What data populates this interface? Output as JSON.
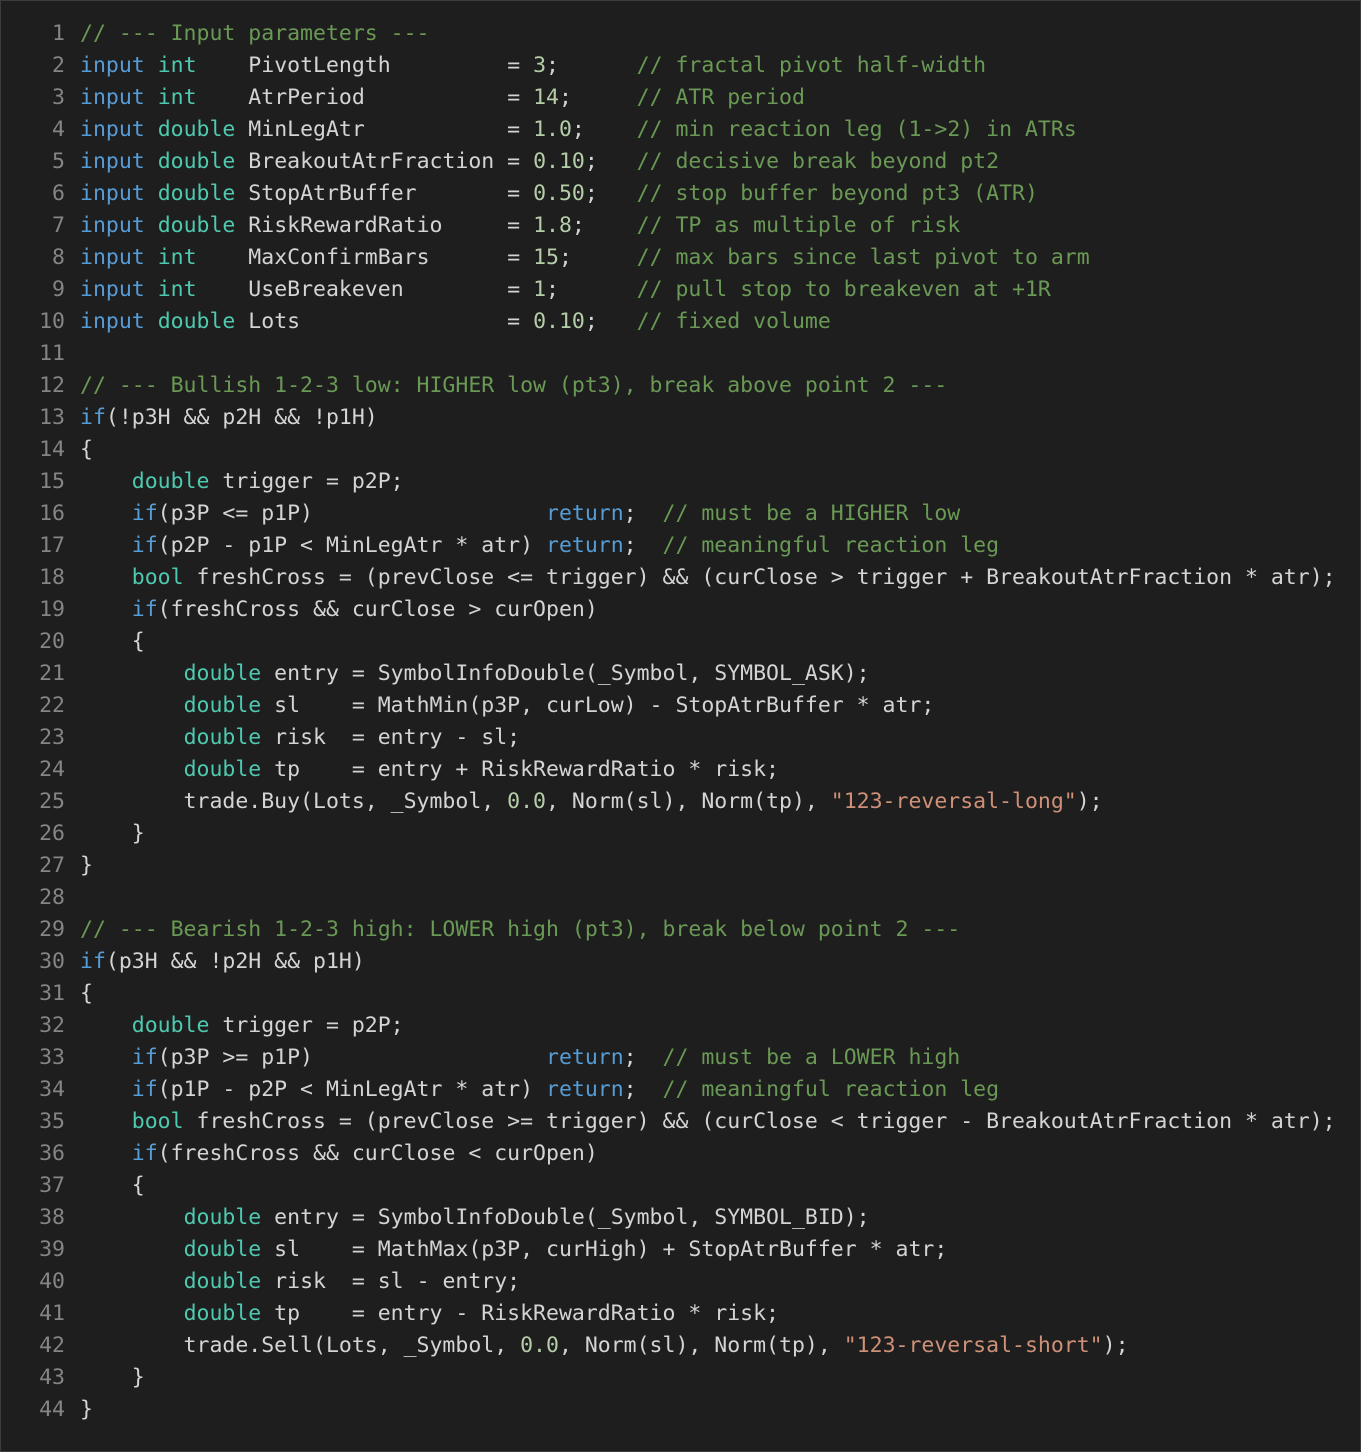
{
  "editor": {
    "background": "#1e1e1e",
    "colors": {
      "plain": "#d4d4d4",
      "keyword": "#569cd6",
      "type": "#4ec9b0",
      "comment": "#6a9955",
      "number": "#b5cea8",
      "string": "#ce9178",
      "line_number": "#858585"
    },
    "lines": [
      {
        "n": "1",
        "tokens": [
          [
            "cm",
            "// --- Input parameters ---"
          ]
        ]
      },
      {
        "n": "2",
        "tokens": [
          [
            "kw",
            "input"
          ],
          [
            "",
            " "
          ],
          [
            "ty",
            "int"
          ],
          [
            "",
            "    PivotLength         = "
          ],
          [
            "num",
            "3"
          ],
          [
            "",
            ";      "
          ],
          [
            "cm",
            "// fractal pivot half-width"
          ]
        ]
      },
      {
        "n": "3",
        "tokens": [
          [
            "kw",
            "input"
          ],
          [
            "",
            " "
          ],
          [
            "ty",
            "int"
          ],
          [
            "",
            "    AtrPeriod           = "
          ],
          [
            "num",
            "14"
          ],
          [
            "",
            ";     "
          ],
          [
            "cm",
            "// ATR period"
          ]
        ]
      },
      {
        "n": "4",
        "tokens": [
          [
            "kw",
            "input"
          ],
          [
            "",
            " "
          ],
          [
            "ty",
            "double"
          ],
          [
            "",
            " MinLegAtr           = "
          ],
          [
            "num",
            "1.0"
          ],
          [
            "",
            ";    "
          ],
          [
            "cm",
            "// min reaction leg (1->2) in ATRs"
          ]
        ]
      },
      {
        "n": "5",
        "tokens": [
          [
            "kw",
            "input"
          ],
          [
            "",
            " "
          ],
          [
            "ty",
            "double"
          ],
          [
            "",
            " BreakoutAtrFraction = "
          ],
          [
            "num",
            "0.10"
          ],
          [
            "",
            ";   "
          ],
          [
            "cm",
            "// decisive break beyond pt2"
          ]
        ]
      },
      {
        "n": "6",
        "tokens": [
          [
            "kw",
            "input"
          ],
          [
            "",
            " "
          ],
          [
            "ty",
            "double"
          ],
          [
            "",
            " StopAtrBuffer       = "
          ],
          [
            "num",
            "0.50"
          ],
          [
            "",
            ";   "
          ],
          [
            "cm",
            "// stop buffer beyond pt3 (ATR)"
          ]
        ]
      },
      {
        "n": "7",
        "tokens": [
          [
            "kw",
            "input"
          ],
          [
            "",
            " "
          ],
          [
            "ty",
            "double"
          ],
          [
            "",
            " RiskRewardRatio     = "
          ],
          [
            "num",
            "1.8"
          ],
          [
            "",
            ";    "
          ],
          [
            "cm",
            "// TP as multiple of risk"
          ]
        ]
      },
      {
        "n": "8",
        "tokens": [
          [
            "kw",
            "input"
          ],
          [
            "",
            " "
          ],
          [
            "ty",
            "int"
          ],
          [
            "",
            "    MaxConfirmBars      = "
          ],
          [
            "num",
            "15"
          ],
          [
            "",
            ";     "
          ],
          [
            "cm",
            "// max bars since last pivot to arm"
          ]
        ]
      },
      {
        "n": "9",
        "tokens": [
          [
            "kw",
            "input"
          ],
          [
            "",
            " "
          ],
          [
            "ty",
            "int"
          ],
          [
            "",
            "    UseBreakeven        = "
          ],
          [
            "num",
            "1"
          ],
          [
            "",
            ";      "
          ],
          [
            "cm",
            "// pull stop to breakeven at +1R"
          ]
        ]
      },
      {
        "n": "10",
        "tokens": [
          [
            "kw",
            "input"
          ],
          [
            "",
            " "
          ],
          [
            "ty",
            "double"
          ],
          [
            "",
            " Lots                = "
          ],
          [
            "num",
            "0.10"
          ],
          [
            "",
            ";   "
          ],
          [
            "cm",
            "// fixed volume"
          ]
        ]
      },
      {
        "n": "11",
        "tokens": []
      },
      {
        "n": "12",
        "tokens": [
          [
            "cm",
            "// --- Bullish 1-2-3 low: HIGHER low (pt3), break above point 2 ---"
          ]
        ]
      },
      {
        "n": "13",
        "tokens": [
          [
            "kw",
            "if"
          ],
          [
            "",
            "(!p3H && p2H && !p1H)"
          ]
        ]
      },
      {
        "n": "14",
        "tokens": [
          [
            "",
            "{"
          ]
        ]
      },
      {
        "n": "15",
        "tokens": [
          [
            "",
            "    "
          ],
          [
            "ty",
            "double"
          ],
          [
            "",
            " trigger = p2P;"
          ]
        ]
      },
      {
        "n": "16",
        "tokens": [
          [
            "",
            "    "
          ],
          [
            "kw",
            "if"
          ],
          [
            "",
            "(p3P <= p1P)                  "
          ],
          [
            "kw",
            "return"
          ],
          [
            "",
            ";  "
          ],
          [
            "cm",
            "// must be a HIGHER low"
          ]
        ]
      },
      {
        "n": "17",
        "tokens": [
          [
            "",
            "    "
          ],
          [
            "kw",
            "if"
          ],
          [
            "",
            "(p2P - p1P < MinLegAtr * atr) "
          ],
          [
            "kw",
            "return"
          ],
          [
            "",
            ";  "
          ],
          [
            "cm",
            "// meaningful reaction leg"
          ]
        ]
      },
      {
        "n": "18",
        "tokens": [
          [
            "",
            "    "
          ],
          [
            "ty",
            "bool"
          ],
          [
            "",
            " freshCross = (prevClose <= trigger) && (curClose > trigger + BreakoutAtrFraction * atr);"
          ]
        ]
      },
      {
        "n": "19",
        "tokens": [
          [
            "",
            "    "
          ],
          [
            "kw",
            "if"
          ],
          [
            "",
            "(freshCross && curClose > curOpen)"
          ]
        ]
      },
      {
        "n": "20",
        "tokens": [
          [
            "",
            "    {"
          ]
        ]
      },
      {
        "n": "21",
        "tokens": [
          [
            "",
            "        "
          ],
          [
            "ty",
            "double"
          ],
          [
            "",
            " entry = SymbolInfoDouble(_Symbol, SYMBOL_ASK);"
          ]
        ]
      },
      {
        "n": "22",
        "tokens": [
          [
            "",
            "        "
          ],
          [
            "ty",
            "double"
          ],
          [
            "",
            " sl    = MathMin(p3P, curLow) - StopAtrBuffer * atr;"
          ]
        ]
      },
      {
        "n": "23",
        "tokens": [
          [
            "",
            "        "
          ],
          [
            "ty",
            "double"
          ],
          [
            "",
            " risk  = entry - sl;"
          ]
        ]
      },
      {
        "n": "24",
        "tokens": [
          [
            "",
            "        "
          ],
          [
            "ty",
            "double"
          ],
          [
            "",
            " tp    = entry + RiskRewardRatio * risk;"
          ]
        ]
      },
      {
        "n": "25",
        "tokens": [
          [
            "",
            "        trade.Buy(Lots, _Symbol, "
          ],
          [
            "num",
            "0.0"
          ],
          [
            "",
            ", Norm(sl), Norm(tp), "
          ],
          [
            "str",
            "\"123-reversal-long\""
          ],
          [
            "",
            ");"
          ]
        ]
      },
      {
        "n": "26",
        "tokens": [
          [
            "",
            "    }"
          ]
        ]
      },
      {
        "n": "27",
        "tokens": [
          [
            "",
            "}"
          ]
        ]
      },
      {
        "n": "28",
        "tokens": []
      },
      {
        "n": "29",
        "tokens": [
          [
            "cm",
            "// --- Bearish 1-2-3 high: LOWER high (pt3), break below point 2 ---"
          ]
        ]
      },
      {
        "n": "30",
        "tokens": [
          [
            "kw",
            "if"
          ],
          [
            "",
            "(p3H && !p2H && p1H)"
          ]
        ]
      },
      {
        "n": "31",
        "tokens": [
          [
            "",
            "{"
          ]
        ]
      },
      {
        "n": "32",
        "tokens": [
          [
            "",
            "    "
          ],
          [
            "ty",
            "double"
          ],
          [
            "",
            " trigger = p2P;"
          ]
        ]
      },
      {
        "n": "33",
        "tokens": [
          [
            "",
            "    "
          ],
          [
            "kw",
            "if"
          ],
          [
            "",
            "(p3P >= p1P)                  "
          ],
          [
            "kw",
            "return"
          ],
          [
            "",
            ";  "
          ],
          [
            "cm",
            "// must be a LOWER high"
          ]
        ]
      },
      {
        "n": "34",
        "tokens": [
          [
            "",
            "    "
          ],
          [
            "kw",
            "if"
          ],
          [
            "",
            "(p1P - p2P < MinLegAtr * atr) "
          ],
          [
            "kw",
            "return"
          ],
          [
            "",
            ";  "
          ],
          [
            "cm",
            "// meaningful reaction leg"
          ]
        ]
      },
      {
        "n": "35",
        "tokens": [
          [
            "",
            "    "
          ],
          [
            "ty",
            "bool"
          ],
          [
            "",
            " freshCross = (prevClose >= trigger) && (curClose < trigger - BreakoutAtrFraction * atr);"
          ]
        ]
      },
      {
        "n": "36",
        "tokens": [
          [
            "",
            "    "
          ],
          [
            "kw",
            "if"
          ],
          [
            "",
            "(freshCross && curClose < curOpen)"
          ]
        ]
      },
      {
        "n": "37",
        "tokens": [
          [
            "",
            "    {"
          ]
        ]
      },
      {
        "n": "38",
        "tokens": [
          [
            "",
            "        "
          ],
          [
            "ty",
            "double"
          ],
          [
            "",
            " entry = SymbolInfoDouble(_Symbol, SYMBOL_BID);"
          ]
        ]
      },
      {
        "n": "39",
        "tokens": [
          [
            "",
            "        "
          ],
          [
            "ty",
            "double"
          ],
          [
            "",
            " sl    = MathMax(p3P, curHigh) + StopAtrBuffer * atr;"
          ]
        ]
      },
      {
        "n": "40",
        "tokens": [
          [
            "",
            "        "
          ],
          [
            "ty",
            "double"
          ],
          [
            "",
            " risk  = sl - entry;"
          ]
        ]
      },
      {
        "n": "41",
        "tokens": [
          [
            "",
            "        "
          ],
          [
            "ty",
            "double"
          ],
          [
            "",
            " tp    = entry - RiskRewardRatio * risk;"
          ]
        ]
      },
      {
        "n": "42",
        "tokens": [
          [
            "",
            "        trade.Sell(Lots, _Symbol, "
          ],
          [
            "num",
            "0.0"
          ],
          [
            "",
            ", Norm(sl), Norm(tp), "
          ],
          [
            "str",
            "\"123-reversal-short\""
          ],
          [
            "",
            ");"
          ]
        ]
      },
      {
        "n": "43",
        "tokens": [
          [
            "",
            "    }"
          ]
        ]
      },
      {
        "n": "44",
        "tokens": [
          [
            "",
            "}"
          ]
        ]
      }
    ]
  }
}
